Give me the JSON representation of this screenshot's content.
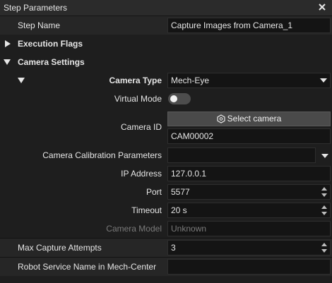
{
  "panel": {
    "title": "Step Parameters"
  },
  "step_name": {
    "label": "Step Name",
    "value": "Capture Images from Camera_1"
  },
  "execution_flags": {
    "label": "Execution Flags"
  },
  "camera_settings": {
    "label": "Camera Settings",
    "camera_type": {
      "label": "Camera Type",
      "value": "Mech-Eye"
    },
    "virtual_mode": {
      "label": "Virtual Mode",
      "enabled": false
    },
    "camera_id": {
      "label": "Camera ID",
      "button": "Select camera",
      "value": "CAM00002"
    },
    "calibration": {
      "label": "Camera Calibration Parameters",
      "value": ""
    },
    "ip_address": {
      "label": "IP Address",
      "value": "127.0.0.1"
    },
    "port": {
      "label": "Port",
      "value": "5577"
    },
    "timeout": {
      "label": "Timeout",
      "value": "20 s"
    },
    "camera_model": {
      "label": "Camera Model",
      "value": "Unknown"
    }
  },
  "max_capture": {
    "label": "Max Capture Attempts",
    "value": "3"
  },
  "robot_service": {
    "label": "Robot Service Name in Mech-Center",
    "value": ""
  },
  "colors": {
    "background": "#1e1e1e",
    "field": "#141414",
    "button": "#4a4a4a",
    "text": "#e6e6e6",
    "disabled_text": "#7a7a7a"
  }
}
